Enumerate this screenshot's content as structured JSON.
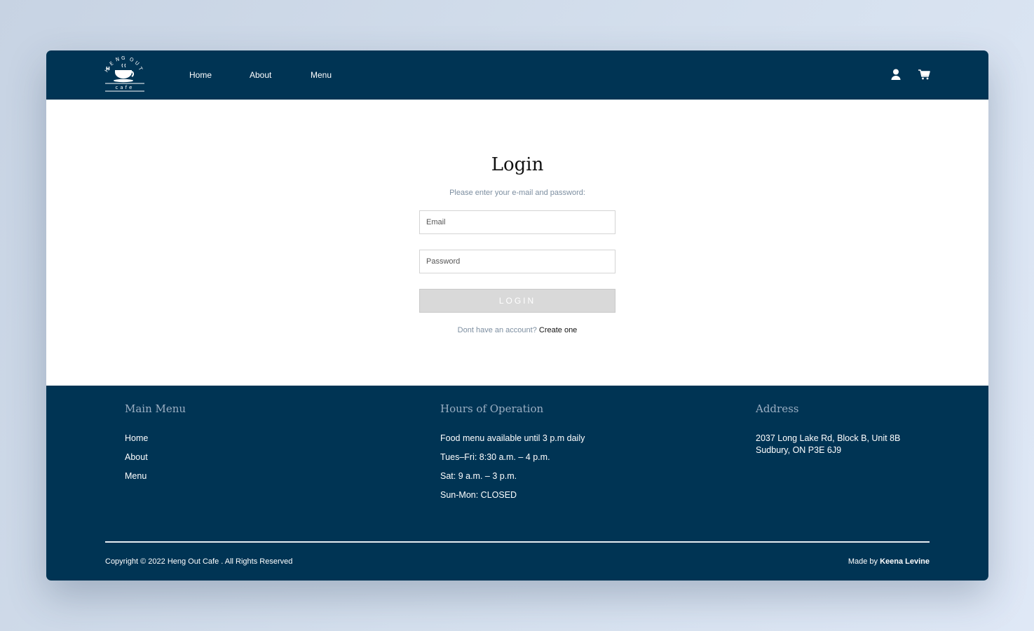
{
  "header": {
    "logo_text": "HENG OUT cafe",
    "nav": [
      {
        "label": "Home"
      },
      {
        "label": "About"
      },
      {
        "label": "Menu"
      }
    ],
    "icons": [
      "user-icon",
      "cart-icon"
    ]
  },
  "login": {
    "title": "Login",
    "subtitle": "Please enter your e-mail and password:",
    "email_placeholder": "Email",
    "password_placeholder": "Password",
    "button_label": "LOGIN",
    "signup_prompt": "Dont have an account?",
    "signup_link": "Create one"
  },
  "footer": {
    "main_menu": {
      "title": "Main Menu",
      "items": [
        "Home",
        "About",
        "Menu"
      ]
    },
    "hours": {
      "title": "Hours of Operation",
      "lines": [
        "Food menu available until 3 p.m daily",
        "Tues–Fri: 8:30 a.m. – 4 p.m.",
        "Sat: 9 a.m. – 3 p.m.",
        "Sun-Mon: CLOSED"
      ]
    },
    "address": {
      "title": "Address",
      "line1": "2037 Long Lake Rd, Block B, Unit 8B",
      "line2": "Sudbury, ON P3E 6J9"
    },
    "copyright": "Copyright © 2022 Heng Out Cafe . All Rights Reserved",
    "made_by_prefix": "Made by",
    "made_by_name": "Keena Levine"
  },
  "colors": {
    "navy": "#003454",
    "muted_text": "#7c8ea0",
    "footer_heading": "#9aaec2",
    "button_disabled": "#d9d9d9"
  }
}
